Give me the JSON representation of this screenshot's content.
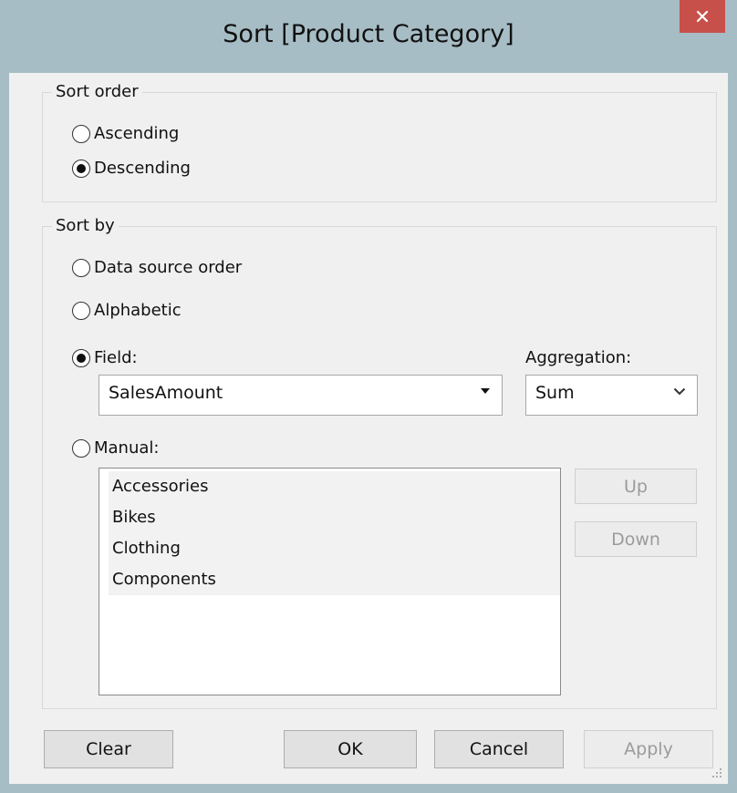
{
  "window": {
    "title": "Sort [Product Category]",
    "close_label": "×"
  },
  "sort_order": {
    "legend": "Sort order",
    "options": [
      {
        "label": "Ascending",
        "selected": false
      },
      {
        "label": "Descending",
        "selected": true
      }
    ]
  },
  "sort_by": {
    "legend": "Sort by",
    "data_source_order_label": "Data source order",
    "alphabetic_label": "Alphabetic",
    "field_label": "Field:",
    "field_selected": true,
    "field_value": "SalesAmount",
    "aggregation_label": "Aggregation:",
    "aggregation_value": "Sum",
    "manual_label": "Manual:",
    "manual_items": [
      "Accessories",
      "Bikes",
      "Clothing",
      "Components"
    ],
    "up_label": "Up",
    "down_label": "Down"
  },
  "buttons": {
    "clear": "Clear",
    "ok": "OK",
    "cancel": "Cancel",
    "apply": "Apply"
  }
}
